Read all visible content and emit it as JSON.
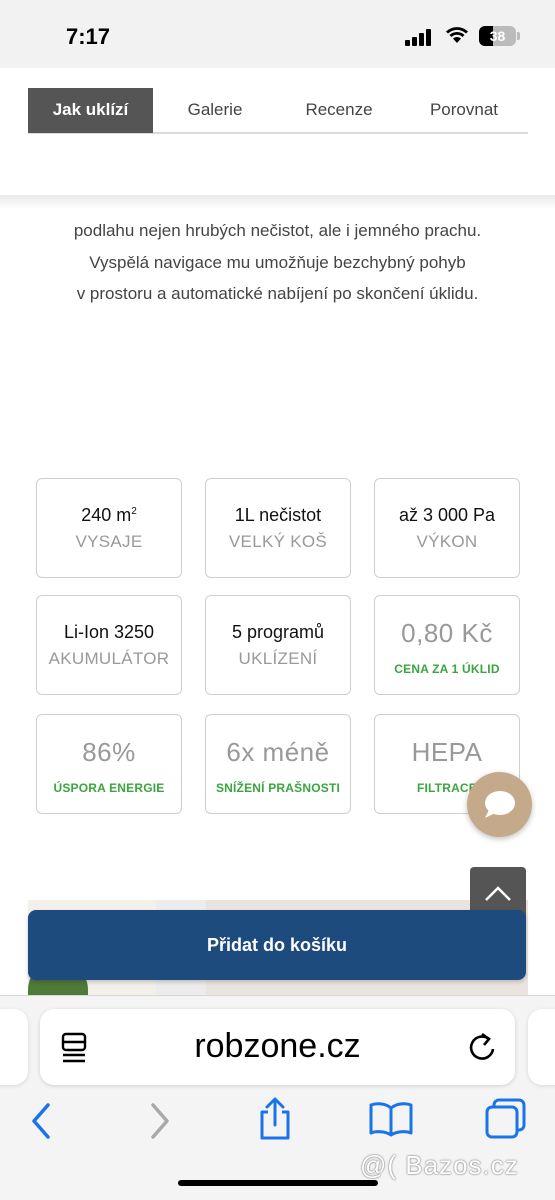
{
  "status_bar": {
    "time": "7:17",
    "battery": "38"
  },
  "tabs": [
    {
      "label": "Jak uklízí",
      "active": true
    },
    {
      "label": "Galerie",
      "active": false
    },
    {
      "label": "Recenze",
      "active": false
    },
    {
      "label": "Porovnat",
      "active": false
    }
  ],
  "description": {
    "line1": "podlahu nejen hrubých nečistot, ale i jemného prachu.",
    "line2": "Vyspělá navigace mu umožňuje bezchybný pohyb",
    "line3": "v prostoru a automatické nabíjení po skončení úklidu."
  },
  "specs": [
    {
      "value": "240 m",
      "value_sup": "2",
      "label": "VYSAJE"
    },
    {
      "value": "1L nečistot",
      "label": "VELKÝ KOŠ"
    },
    {
      "value": "až 3 000 Pa",
      "label": "VÝKON"
    },
    {
      "value": "Li-Ion 3250",
      "label": "AKUMULÁTOR"
    },
    {
      "value": "5 programů",
      "label": "UKLÍZENÍ"
    },
    {
      "value": "0,80 Kč",
      "label": "CENA ZA 1 ÚKLID"
    },
    {
      "value": "86%",
      "label": "ÚSPORA ENERGIE"
    },
    {
      "value": "6x méně",
      "label": "SNÍŽENÍ PRAŠNOSTI"
    },
    {
      "value": "HEPA",
      "label": "FILTRACE"
    }
  ],
  "cart_button": "Přidat do košíku",
  "browser": {
    "url": "robzone.cz"
  },
  "watermark": "@( Bazos.cz",
  "colors": {
    "cart": "#1e4b7e",
    "chat": "#c4aa8b",
    "green": "#3aa640",
    "tab_active": "#555555"
  }
}
